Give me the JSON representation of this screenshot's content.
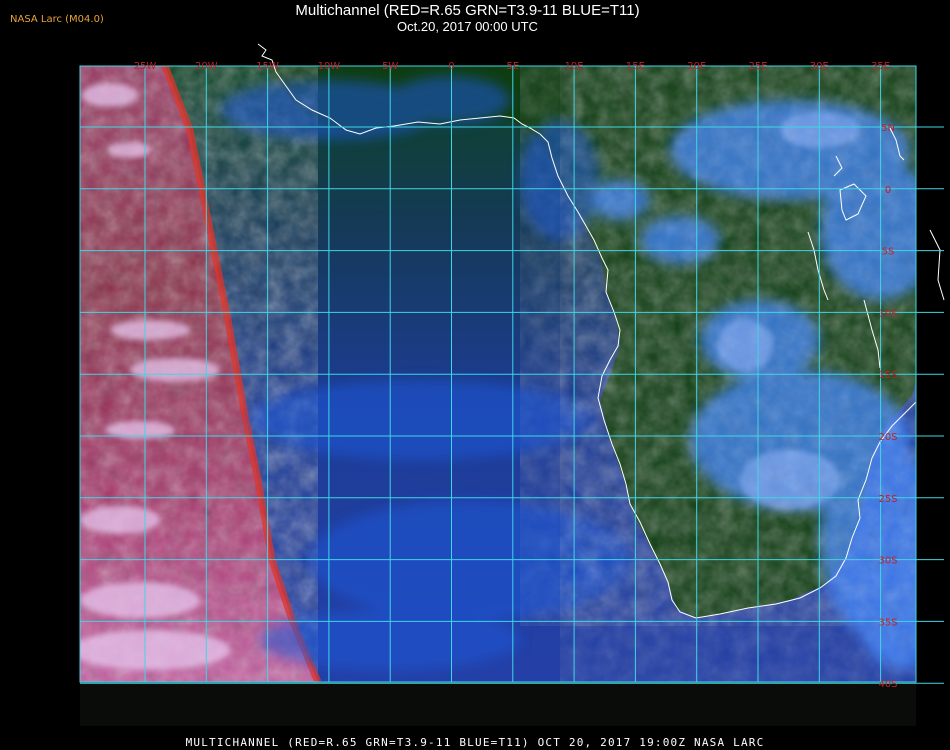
{
  "header": {
    "corner_label": "NASA Larc (M04.0)",
    "title": "Multichannel (RED=R.65 GRN=T3.9-11 BLUE=T11)",
    "subtitle": "Oct.20, 2017 00:00 UTC"
  },
  "footer": {
    "label": "MULTICHANNEL (RED=R.65 GRN=T3.9-11 BLUE=T11) OCT 20, 2017 19:00Z   NASA LARC"
  },
  "map": {
    "longitude_labels": [
      "25W",
      "20W",
      "15W",
      "10W",
      "5W",
      "0",
      "5E",
      "10E",
      "15E",
      "20E",
      "25E",
      "30E",
      "35E"
    ],
    "latitude_labels": [
      "5N",
      "0",
      "5S",
      "10S",
      "15S",
      "20S",
      "25S",
      "30S",
      "35S",
      "40S"
    ],
    "colors": {
      "grid": "#3fd6e6",
      "coastline": "#ffffff",
      "land_vegetation": "#0f3f14",
      "ocean_clear": "#1e3c9a",
      "cloud_cold": "#4a8cf0",
      "cloud_edge_red": "#d2326a",
      "cloud_white": "#e6d2f0"
    }
  }
}
